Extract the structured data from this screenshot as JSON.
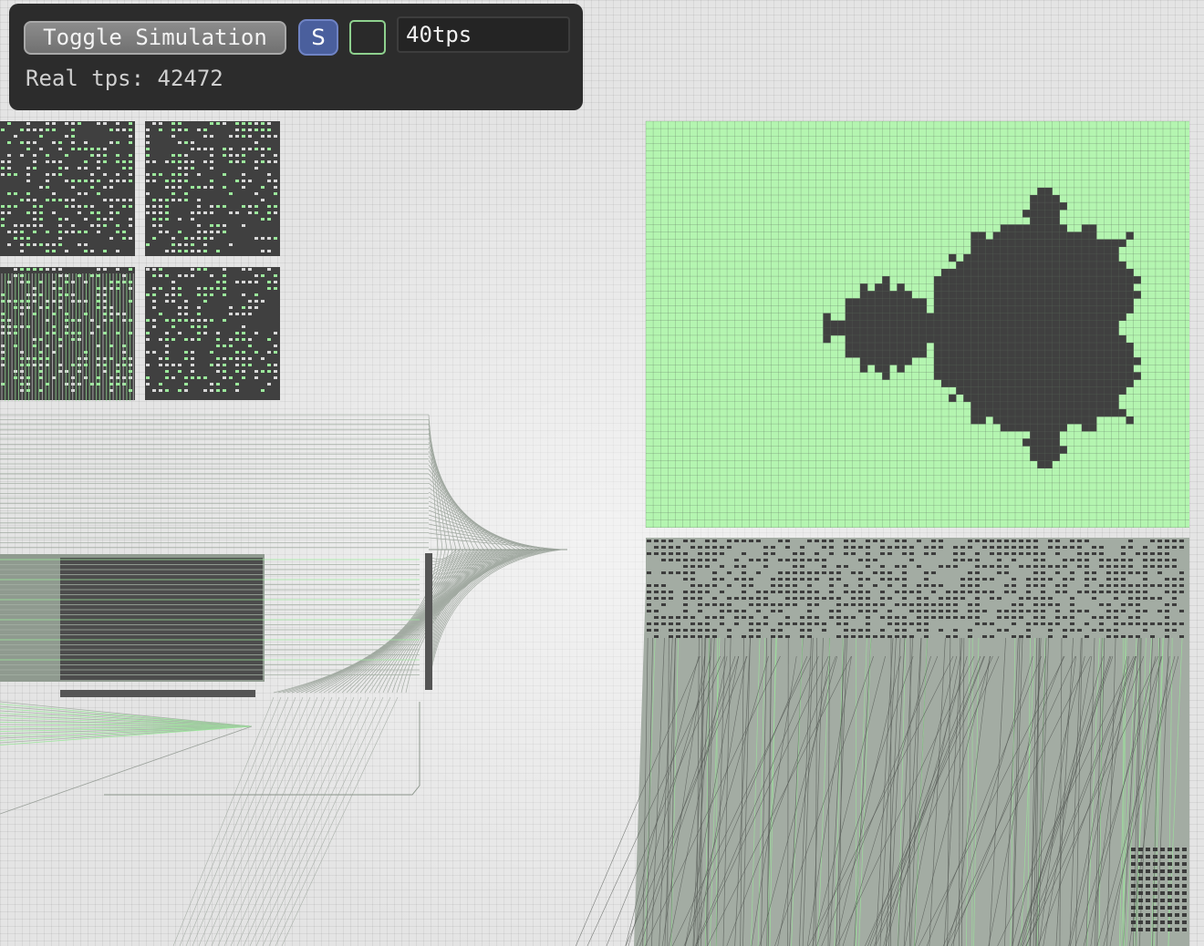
{
  "toolbar": {
    "toggle_label": "Toggle Simulation",
    "s_label": "S",
    "tps_value": "40tps",
    "real_tps_label": "Real tps:",
    "real_tps_value": "42472"
  },
  "colors": {
    "panel_bg": "#2c2c2c",
    "wire_on": "#9be89b",
    "wire_off": "#8f9d8f",
    "display_on": "#b4f5b0",
    "display_off": "#404040",
    "accent_blue": "#4a5f9d"
  },
  "display": {
    "content": "mandelbrot-set"
  }
}
